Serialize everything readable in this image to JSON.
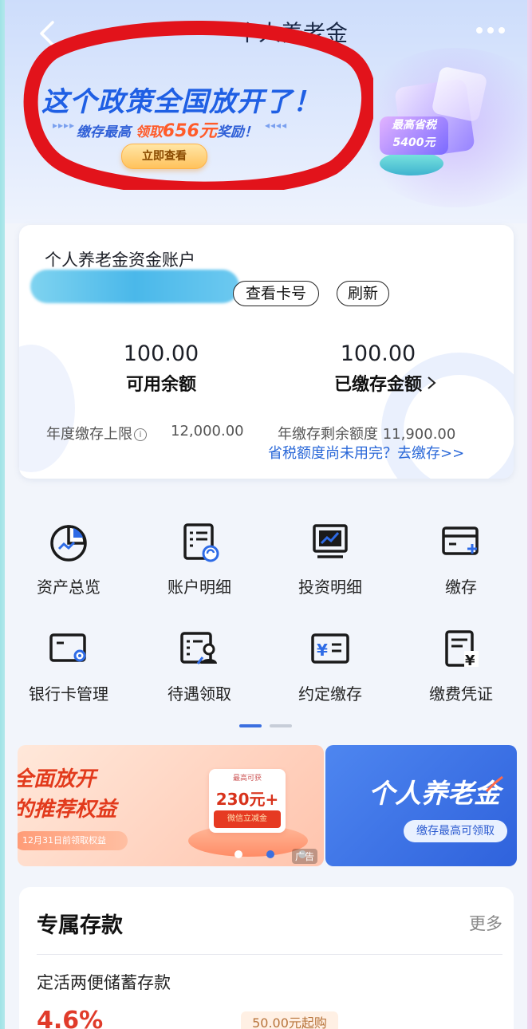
{
  "header": {
    "title": "个人养老金",
    "back_icon": "back-arrow-icon",
    "more_icon": "more-dots-icon"
  },
  "banner": {
    "headline": "这个政策全国放开了！",
    "sub_pre": "缴存最高",
    "sub_hl": "领取",
    "sub_amount": "656元",
    "sub_post": "奖励！",
    "cta": "立即查看",
    "tax_line1": "最高省税",
    "tax_line2": "5400元",
    "annotation_color": "#e2131b"
  },
  "account": {
    "title": "个人养老金资金账户",
    "view_card_label": "查看卡号",
    "refresh_label": "刷新",
    "available_amount": "100.00",
    "available_label": "可用余额",
    "deposited_amount": "100.00",
    "deposited_label": "已缴存金额",
    "annual_limit_label": "年度缴存上限",
    "annual_limit_value": "12,000.00",
    "remaining_label": "年缴存剩余额度 11,900.00",
    "tax_link": "省税额度尚未用完？去缴存>>"
  },
  "grid": [
    {
      "label": "资产总览",
      "icon": "asset-overview-icon"
    },
    {
      "label": "账户明细",
      "icon": "account-detail-icon"
    },
    {
      "label": "投资明细",
      "icon": "investment-detail-icon"
    },
    {
      "label": "缴存",
      "icon": "deposit-card-icon"
    },
    {
      "label": "银行卡管理",
      "icon": "bank-card-manage-icon"
    },
    {
      "label": "待遇领取",
      "icon": "benefit-claim-icon"
    },
    {
      "label": "约定缴存",
      "icon": "scheduled-deposit-icon"
    },
    {
      "label": "缴费凭证",
      "icon": "payment-voucher-icon"
    }
  ],
  "promo_left": {
    "line1": "全面放开",
    "line2": "的推荐权益",
    "line3": "12月31日前领取权益",
    "coupon_top": "最高可获",
    "coupon_value": "230元+",
    "coupon_bottom": "微信立减金",
    "ad_label": "广告"
  },
  "promo_right": {
    "title": "个人养老金",
    "sub": "缴存最高可领取"
  },
  "deposit": {
    "title": "专属存款",
    "more": "更多",
    "product": "定活两便储蓄存款",
    "rate": "4.6%",
    "min": "50.00元起购"
  },
  "colors": {
    "primary_blue": "#2a68d8",
    "accent_orange": "#ff5b2a",
    "pager_active": "#3b6fe0"
  }
}
